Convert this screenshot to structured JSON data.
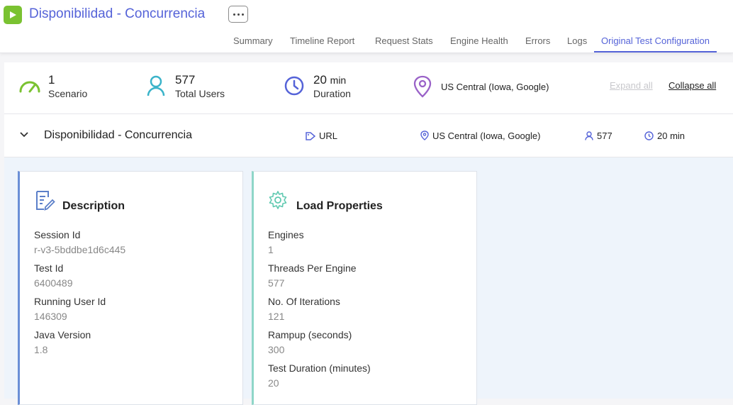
{
  "header": {
    "title": "Disponibilidad - Concurrencia",
    "tabs": [
      "Summary",
      "Timeline Report",
      "Request Stats",
      "Engine Health",
      "Errors",
      "Logs",
      "Original Test Configuration"
    ],
    "active_tab": "Original Test Configuration"
  },
  "stats": {
    "scenarios": {
      "value": "1",
      "label": "Scenario"
    },
    "users": {
      "value": "577",
      "label": "Total Users"
    },
    "duration": {
      "value": "20",
      "unit": "min",
      "label": "Duration"
    },
    "location": "US Central (Iowa, Google)",
    "expand_all": "Expand all",
    "collapse_all": "Collapse all"
  },
  "scenario": {
    "name": "Disponibilidad - Concurrencia",
    "type": "URL",
    "location": "US Central (Iowa, Google)",
    "users": "577",
    "duration": "20 min"
  },
  "description": {
    "title": "Description",
    "fields": [
      {
        "label": "Session Id",
        "value": "r-v3-5bddbe1d6c445"
      },
      {
        "label": "Test Id",
        "value": "6400489"
      },
      {
        "label": "Running User Id",
        "value": "146309"
      },
      {
        "label": "Java Version",
        "value": "1.8"
      }
    ]
  },
  "load": {
    "title": "Load Properties",
    "fields": [
      {
        "label": "Engines",
        "value": "1"
      },
      {
        "label": "Threads Per Engine",
        "value": "577"
      },
      {
        "label": "No. Of Iterations",
        "value": "121"
      },
      {
        "label": "Rampup (seconds)",
        "value": "300"
      },
      {
        "label": "Test Duration (minutes)",
        "value": "20"
      }
    ]
  },
  "colors": {
    "accent": "#5563d8",
    "play": "#7ac231"
  }
}
